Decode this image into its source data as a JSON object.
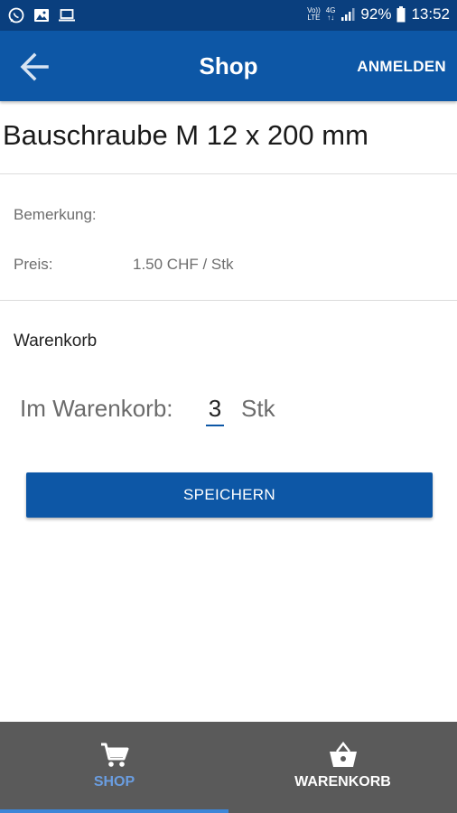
{
  "status_bar": {
    "volte_top": "Vo))",
    "volte_bottom": "LTE",
    "network": "4G",
    "battery": "92%",
    "time": "13:52"
  },
  "app_bar": {
    "title": "Shop",
    "login_label": "ANMELDEN"
  },
  "product": {
    "title": "Bauschraube M 12 x 200 mm",
    "remark_label": "Bemerkung:",
    "remark_value": "",
    "price_label": "Preis:",
    "price_value": "1.50 CHF / Stk"
  },
  "cart_section": {
    "title": "Warenkorb",
    "in_cart_label": "Im Warenkorb:",
    "quantity": "3",
    "unit": "Stk",
    "save_label": "SPEICHERN"
  },
  "bottom_nav": {
    "items": [
      {
        "label": "SHOP",
        "icon": "cart-icon",
        "active": true
      },
      {
        "label": "WARENKORB",
        "icon": "basket-icon",
        "active": false
      }
    ]
  },
  "colors": {
    "status_bar": "#0a3f7e",
    "primary": "#0d57a6",
    "bottom_nav": "#5a5a5a",
    "active_tab": "#6a9de0"
  }
}
